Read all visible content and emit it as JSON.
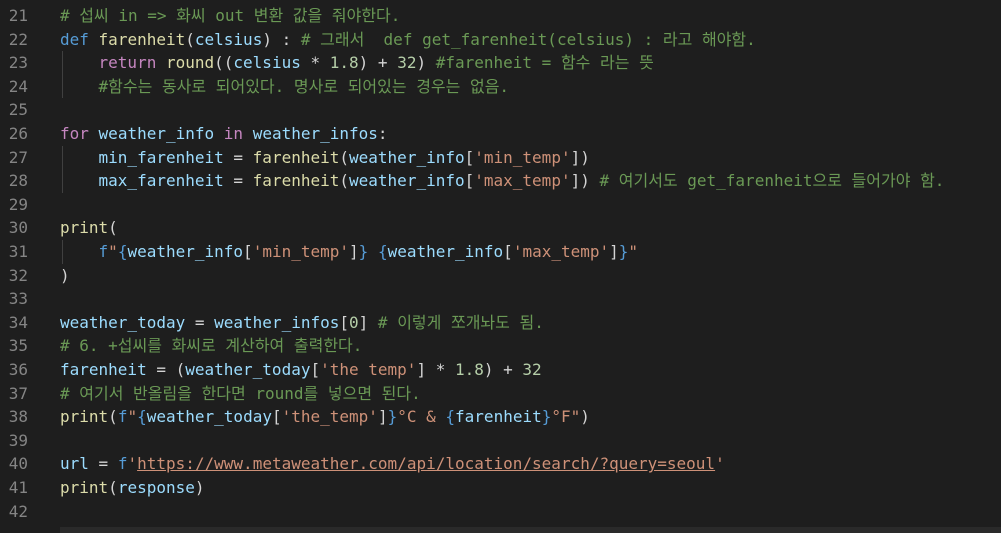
{
  "editor": {
    "lines": [
      {
        "n": "21",
        "tokens": [
          {
            "t": "# 섭씨 in => 화씨 out 변환 값을 줘야한다.",
            "c": "cmt"
          }
        ]
      },
      {
        "n": "22",
        "tokens": [
          {
            "t": "def",
            "c": "kw"
          },
          {
            "t": " ",
            "c": "op"
          },
          {
            "t": "farenheit",
            "c": "fn"
          },
          {
            "t": "(",
            "c": "op"
          },
          {
            "t": "celsius",
            "c": "var"
          },
          {
            "t": ") : ",
            "c": "op"
          },
          {
            "t": "# 그래서  def get_farenheit(celsius) : 라고 해야함.",
            "c": "cmt"
          }
        ]
      },
      {
        "n": "23",
        "tokens": [
          {
            "t": "    ",
            "c": "op"
          },
          {
            "t": "return",
            "c": "ctrl"
          },
          {
            "t": " ",
            "c": "op"
          },
          {
            "t": "round",
            "c": "fn"
          },
          {
            "t": "((",
            "c": "op"
          },
          {
            "t": "celsius",
            "c": "var"
          },
          {
            "t": " * ",
            "c": "op"
          },
          {
            "t": "1.8",
            "c": "num"
          },
          {
            "t": ") + ",
            "c": "op"
          },
          {
            "t": "32",
            "c": "num"
          },
          {
            "t": ") ",
            "c": "op"
          },
          {
            "t": "#farenheit = 함수 라는 뜻",
            "c": "cmt"
          }
        ]
      },
      {
        "n": "24",
        "tokens": [
          {
            "t": "    ",
            "c": "op"
          },
          {
            "t": "#함수는 동사로 되어있다. 명사로 되어있는 경우는 없음.",
            "c": "cmt"
          }
        ]
      },
      {
        "n": "25",
        "tokens": []
      },
      {
        "n": "26",
        "tokens": [
          {
            "t": "for",
            "c": "ctrl"
          },
          {
            "t": " ",
            "c": "op"
          },
          {
            "t": "weather_info",
            "c": "var"
          },
          {
            "t": " ",
            "c": "op"
          },
          {
            "t": "in",
            "c": "ctrl"
          },
          {
            "t": " ",
            "c": "op"
          },
          {
            "t": "weather_infos",
            "c": "var"
          },
          {
            "t": ":",
            "c": "op"
          }
        ]
      },
      {
        "n": "27",
        "tokens": [
          {
            "t": "    ",
            "c": "op"
          },
          {
            "t": "min_farenheit",
            "c": "var"
          },
          {
            "t": " = ",
            "c": "op"
          },
          {
            "t": "farenheit",
            "c": "fn"
          },
          {
            "t": "(",
            "c": "op"
          },
          {
            "t": "weather_info",
            "c": "var"
          },
          {
            "t": "[",
            "c": "op"
          },
          {
            "t": "'min_temp'",
            "c": "str"
          },
          {
            "t": "])",
            "c": "op"
          }
        ]
      },
      {
        "n": "28",
        "tokens": [
          {
            "t": "    ",
            "c": "op"
          },
          {
            "t": "max_farenheit",
            "c": "var"
          },
          {
            "t": " = ",
            "c": "op"
          },
          {
            "t": "farenheit",
            "c": "fn"
          },
          {
            "t": "(",
            "c": "op"
          },
          {
            "t": "weather_info",
            "c": "var"
          },
          {
            "t": "[",
            "c": "op"
          },
          {
            "t": "'max_temp'",
            "c": "str"
          },
          {
            "t": "]) ",
            "c": "op"
          },
          {
            "t": "# 여기서도 get_farenheit으로 들어가야 함.",
            "c": "cmt"
          }
        ]
      },
      {
        "n": "29",
        "tokens": []
      },
      {
        "n": "30",
        "tokens": [
          {
            "t": "print",
            "c": "fn"
          },
          {
            "t": "(",
            "c": "op"
          }
        ]
      },
      {
        "n": "31",
        "tokens": [
          {
            "t": "    ",
            "c": "op"
          },
          {
            "t": "f",
            "c": "kw"
          },
          {
            "t": "\"",
            "c": "str"
          },
          {
            "t": "{",
            "c": "brace"
          },
          {
            "t": "weather_info",
            "c": "var"
          },
          {
            "t": "[",
            "c": "op"
          },
          {
            "t": "'min_temp'",
            "c": "str"
          },
          {
            "t": "]",
            "c": "op"
          },
          {
            "t": "}",
            "c": "brace"
          },
          {
            "t": " ",
            "c": "str"
          },
          {
            "t": "{",
            "c": "brace"
          },
          {
            "t": "weather_info",
            "c": "var"
          },
          {
            "t": "[",
            "c": "op"
          },
          {
            "t": "'max_temp'",
            "c": "str"
          },
          {
            "t": "]",
            "c": "op"
          },
          {
            "t": "}",
            "c": "brace"
          },
          {
            "t": "\"",
            "c": "str"
          }
        ]
      },
      {
        "n": "32",
        "tokens": [
          {
            "t": ")",
            "c": "op"
          }
        ]
      },
      {
        "n": "33",
        "tokens": []
      },
      {
        "n": "34",
        "tokens": [
          {
            "t": "weather_today",
            "c": "var"
          },
          {
            "t": " = ",
            "c": "op"
          },
          {
            "t": "weather_infos",
            "c": "var"
          },
          {
            "t": "[",
            "c": "op"
          },
          {
            "t": "0",
            "c": "num"
          },
          {
            "t": "] ",
            "c": "op"
          },
          {
            "t": "# 이렇게 쪼개놔도 됨.",
            "c": "cmt"
          }
        ]
      },
      {
        "n": "35",
        "tokens": [
          {
            "t": "# 6. +섭씨를 화씨로 계산하여 출력한다.",
            "c": "cmt"
          }
        ]
      },
      {
        "n": "36",
        "tokens": [
          {
            "t": "farenheit",
            "c": "var"
          },
          {
            "t": " = (",
            "c": "op"
          },
          {
            "t": "weather_today",
            "c": "var"
          },
          {
            "t": "[",
            "c": "op"
          },
          {
            "t": "'the temp'",
            "c": "str"
          },
          {
            "t": "] * ",
            "c": "op"
          },
          {
            "t": "1.8",
            "c": "num"
          },
          {
            "t": ") + ",
            "c": "op"
          },
          {
            "t": "32",
            "c": "num"
          }
        ]
      },
      {
        "n": "37",
        "tokens": [
          {
            "t": "# 여기서 반올림을 한다면 round를 넣으면 된다.",
            "c": "cmt"
          }
        ]
      },
      {
        "n": "38",
        "tokens": [
          {
            "t": "print",
            "c": "fn"
          },
          {
            "t": "(",
            "c": "op"
          },
          {
            "t": "f",
            "c": "kw"
          },
          {
            "t": "\"",
            "c": "str"
          },
          {
            "t": "{",
            "c": "brace"
          },
          {
            "t": "weather_today",
            "c": "var"
          },
          {
            "t": "[",
            "c": "op"
          },
          {
            "t": "'the_temp'",
            "c": "str"
          },
          {
            "t": "]",
            "c": "op"
          },
          {
            "t": "}",
            "c": "brace"
          },
          {
            "t": "°C & ",
            "c": "str"
          },
          {
            "t": "{",
            "c": "brace"
          },
          {
            "t": "farenheit",
            "c": "var"
          },
          {
            "t": "}",
            "c": "brace"
          },
          {
            "t": "°F\"",
            "c": "str"
          },
          {
            "t": ")",
            "c": "op"
          }
        ]
      },
      {
        "n": "39",
        "tokens": []
      },
      {
        "n": "40",
        "tokens": [
          {
            "t": "url",
            "c": "var"
          },
          {
            "t": " = ",
            "c": "op"
          },
          {
            "t": "f",
            "c": "kw"
          },
          {
            "t": "'",
            "c": "str"
          },
          {
            "t": "https://www.metaweather.com/api/location/search/?query=seoul",
            "c": "url"
          },
          {
            "t": "'",
            "c": "str"
          }
        ]
      },
      {
        "n": "41",
        "tokens": [
          {
            "t": "print",
            "c": "fn"
          },
          {
            "t": "(",
            "c": "op"
          },
          {
            "t": "response",
            "c": "var"
          },
          {
            "t": ")",
            "c": "op"
          }
        ]
      },
      {
        "n": "42",
        "tokens": []
      }
    ]
  }
}
